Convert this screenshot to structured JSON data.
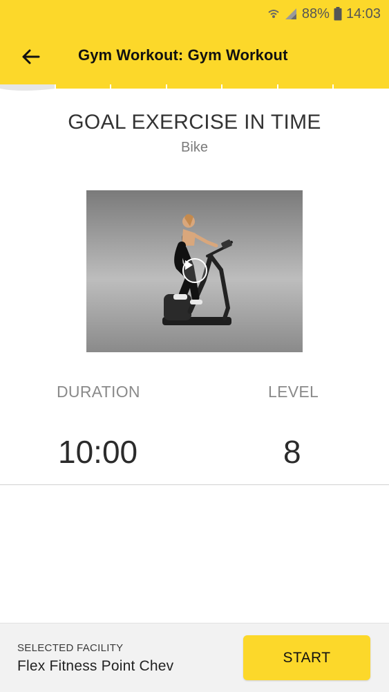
{
  "status_bar": {
    "battery": "88%",
    "time": "14:03",
    "icons": [
      "wifi-icon",
      "signal-icon",
      "battery-icon"
    ]
  },
  "header": {
    "title": "Gym Workout: Gym Workout",
    "back_icon": "arrow-left-icon"
  },
  "exercise": {
    "title": "GOAL EXERCISE IN TIME",
    "subtitle": "Bike",
    "video_icon": "play-icon"
  },
  "stats": {
    "duration_label": "DURATION",
    "duration_value": "10:00",
    "level_label": "LEVEL",
    "level_value": "8"
  },
  "footer": {
    "facility_caption": "SELECTED FACILITY",
    "facility_name": "Flex Fitness Point Chev",
    "start_label": "START"
  },
  "colors": {
    "accent": "#FCD82A",
    "text_dark": "#2b2b2b",
    "text_muted": "#8a8a8a"
  }
}
